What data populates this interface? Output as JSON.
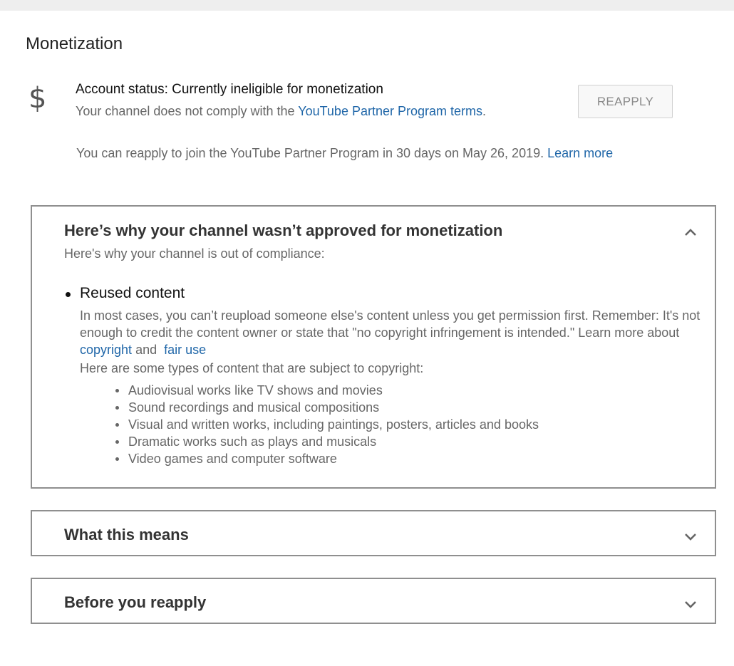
{
  "header": {
    "title": "Monetization"
  },
  "account": {
    "icon": "dollar-icon",
    "icon_glyph": "$",
    "status": "Account status: Currently ineligible for monetization",
    "desc_prefix": "Your channel does not comply with the ",
    "desc_link": "YouTube Partner Program terms",
    "desc_suffix": ".",
    "reapply_label": "REAPPLY",
    "reapply_note": "You can reapply to join the YouTube Partner Program in 30 days on May 26, 2019.",
    "learn_more": "Learn more"
  },
  "sections": {
    "why": {
      "title": "Here’s why your channel wasn’t approved for monetization",
      "intro": "Here's why your channel is out of compliance:",
      "reason": {
        "title": "Reused content",
        "desc": "In most cases, you can’t reupload someone else's content unless you get permission first. Remember: It's not enough to credit the content owner or state that \"no copyright infringement is intended.\" Learn more about ",
        "link_copyright": "copyright",
        "and": "and",
        "link_fair_use": "fair use",
        "types_intro": "Here are some types of content that are subject to copyright:",
        "types": [
          "Audiovisual works like TV shows and movies",
          "Sound recordings and musical compositions",
          "Visual and written works, including paintings, posters, articles and books",
          "Dramatic works such as plays and musicals",
          "Video games and computer software"
        ]
      }
    },
    "means": {
      "title": "What this means"
    },
    "before": {
      "title": "Before you reapply"
    }
  },
  "colors": {
    "link": "#1f66a8",
    "border": "#8f8f8f",
    "muted_text": "#666666"
  }
}
